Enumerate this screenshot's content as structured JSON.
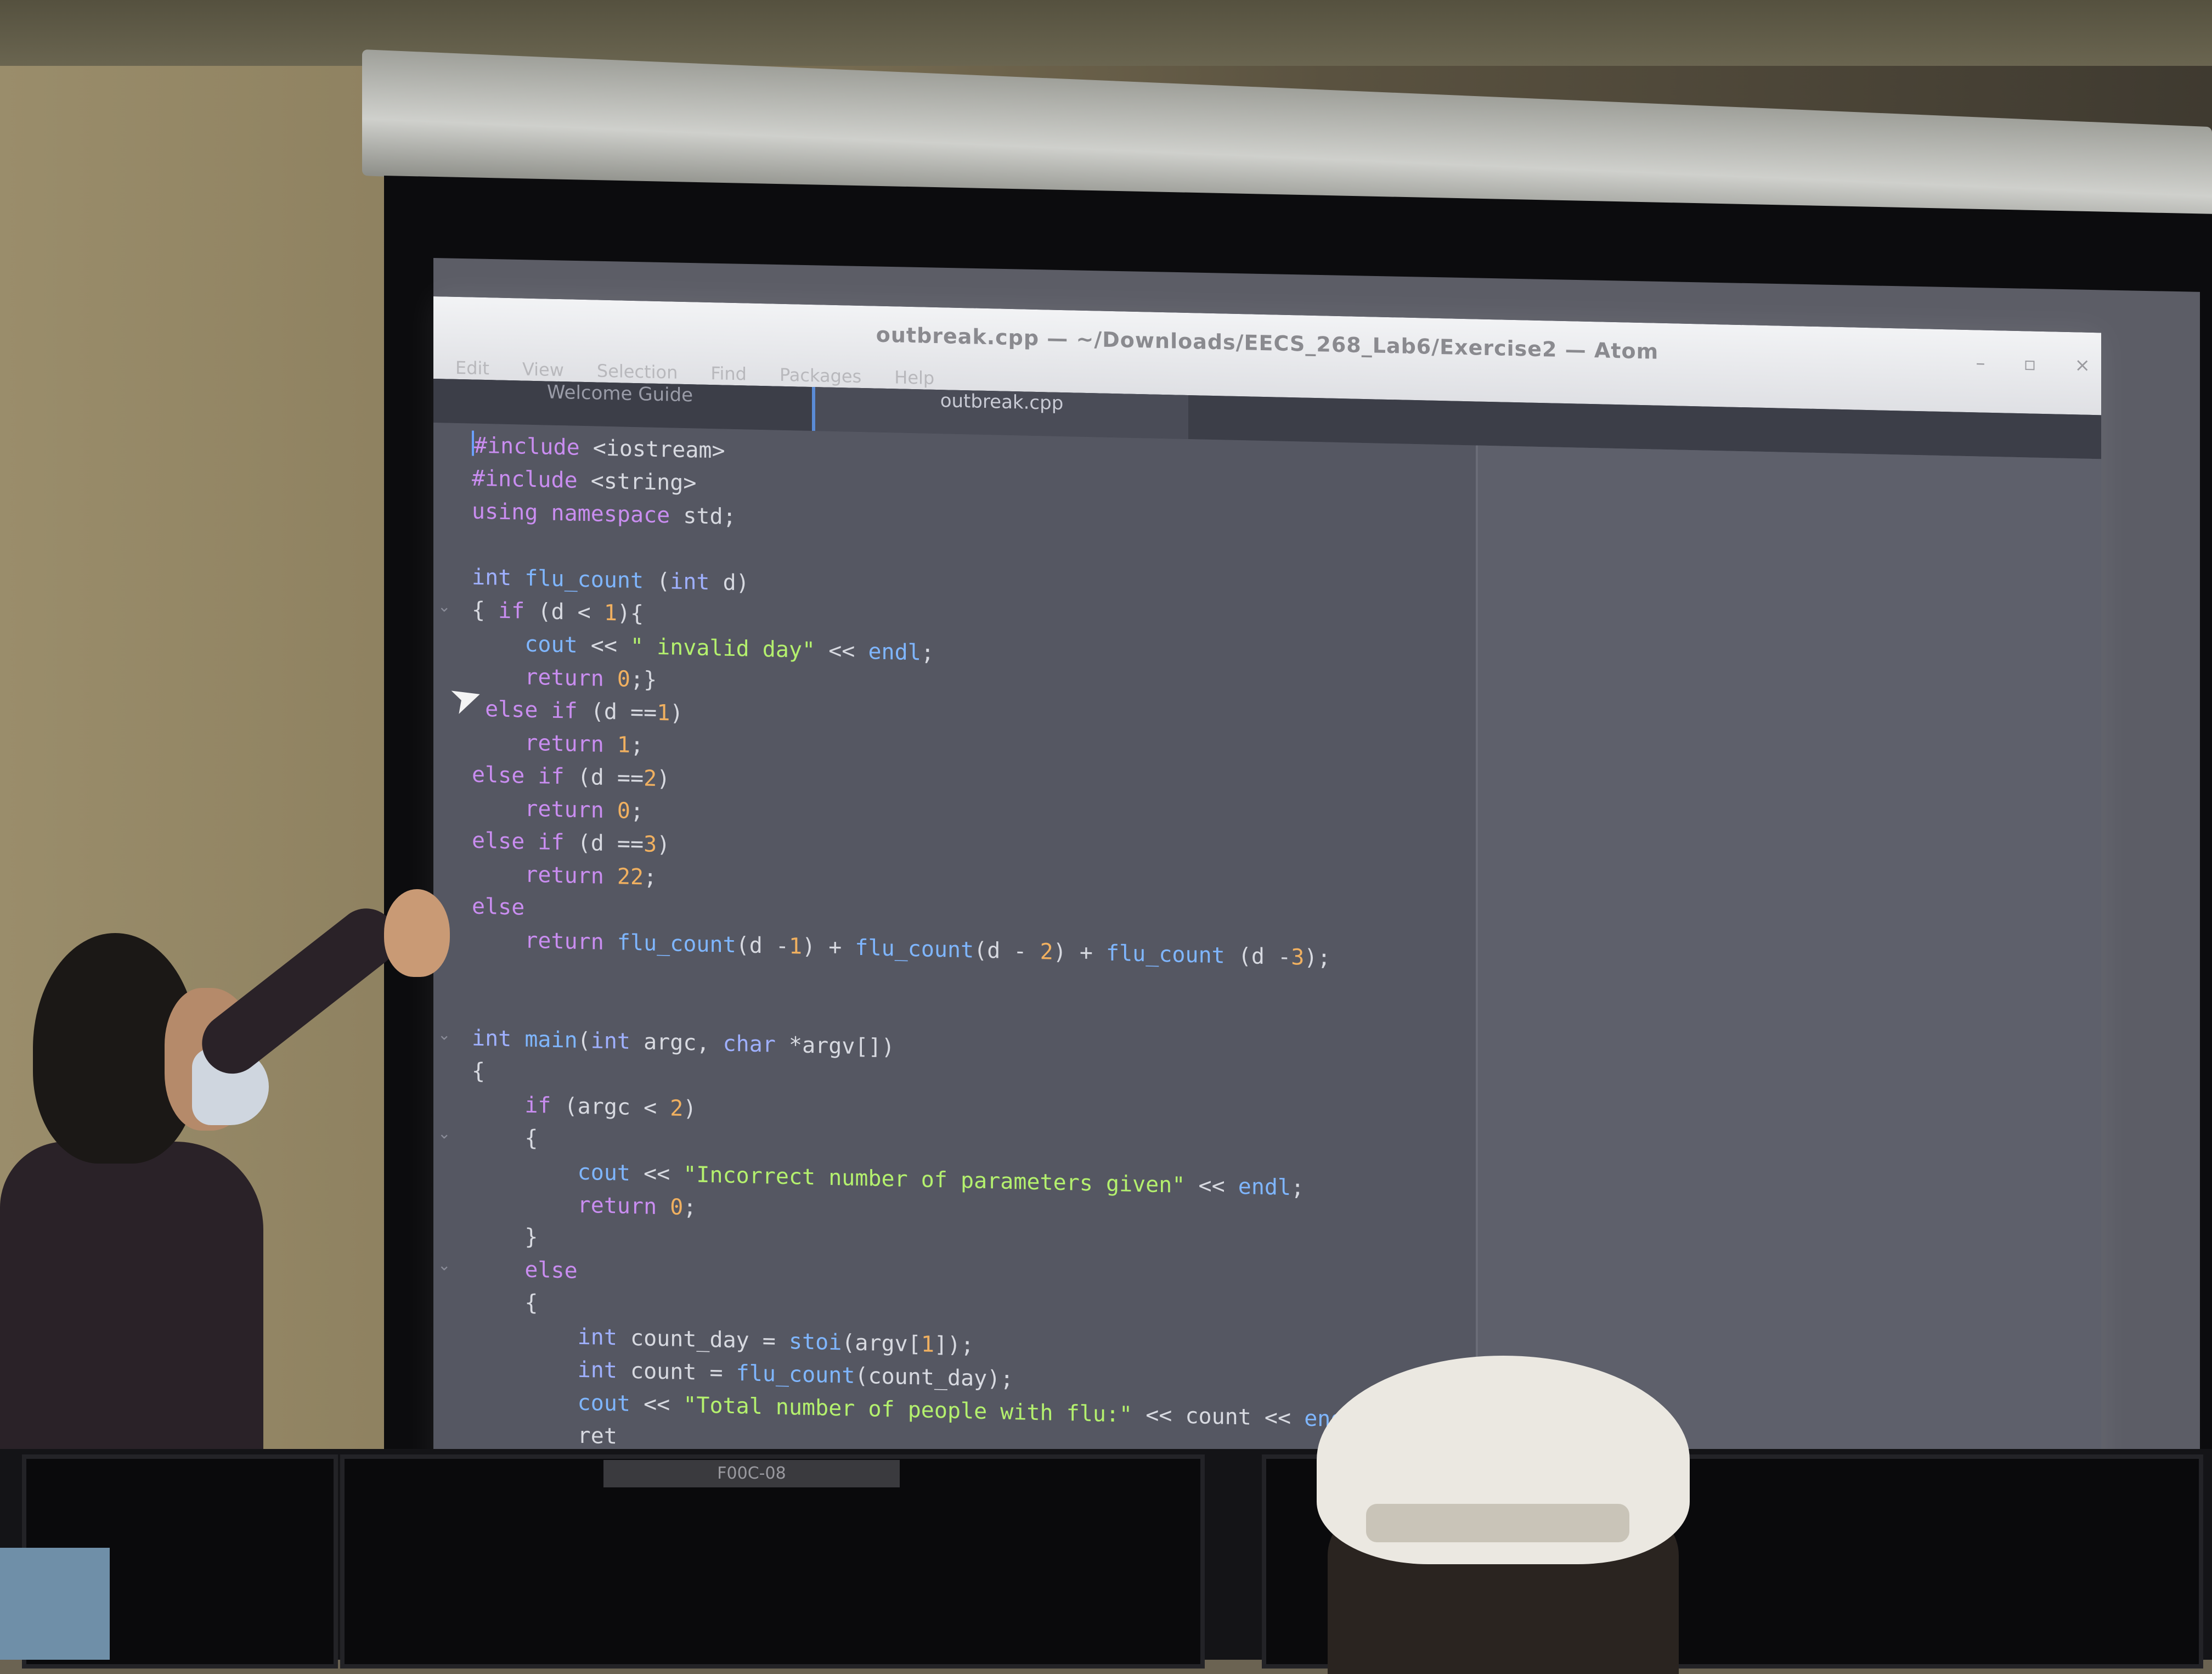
{
  "window": {
    "title": "outbreak.cpp — ~/Downloads/EECS_268_Lab6/Exercise2 — Atom",
    "menu": [
      "Edit",
      "View",
      "Selection",
      "Find",
      "Packages",
      "Help"
    ],
    "controls": [
      "–",
      "▫",
      "×"
    ]
  },
  "tabs": [
    {
      "label": "Welcome Guide",
      "active": false
    },
    {
      "label": "outbreak.cpp",
      "active": true
    }
  ],
  "code_lines": [
    "#include <iostream>",
    "#include <string>",
    "using namespace std;",
    "",
    "int flu_count (int d)",
    "{ if (d < 1){",
    "    cout << \" invalid day\" << endl;",
    "    return 0;}",
    " else if (d ==1)",
    "    return 1;",
    "else if (d ==2)",
    "    return 0;",
    "else if (d ==3)",
    "    return 22;",
    "else",
    "    return flu_count(d -1) + flu_count(d - 2) + flu_count (d -3);",
    "",
    "",
    "int main(int argc, char *argv[])",
    "{",
    "    if (argc < 2)",
    "    {",
    "        cout << \"Incorrect number of parameters given\" << endl;",
    "        return 0;",
    "    }",
    "    else",
    "    {",
    "        int count_day = stoi(argv[1]);",
    "        int count = flu_count(count_day);",
    "        cout << \"Total number of people with flu:\" << count << endl;",
    "        ret"
  ],
  "monitor_label": "F00C-08",
  "colors": {
    "keyword": "#c98df0",
    "type": "#9fb0ff",
    "function": "#7fb6ff",
    "string": "#b4f06e",
    "number": "#f0b060",
    "editor_bg": "#555762"
  }
}
